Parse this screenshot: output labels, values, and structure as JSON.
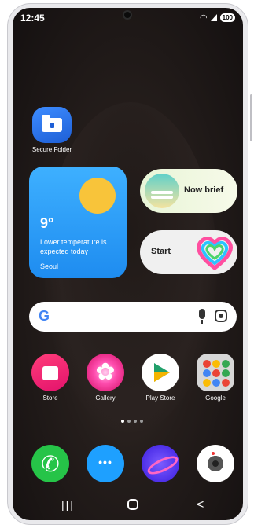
{
  "status": {
    "time": "12:45",
    "battery": "100"
  },
  "secure_folder": {
    "label": "Secure Folder"
  },
  "weather": {
    "temp": "9°",
    "description": "Lower temperature is expected today",
    "city": "Seoul"
  },
  "now_brief": {
    "label": "Now brief"
  },
  "start_widget": {
    "label": "Start"
  },
  "search": {
    "logo": "G"
  },
  "apps_row": [
    {
      "label": "Store"
    },
    {
      "label": "Gallery"
    },
    {
      "label": "Play Store"
    },
    {
      "label": "Google"
    }
  ],
  "pager": {
    "pages": 4,
    "active": 0
  },
  "nav": {
    "recent": "|||",
    "back": "<"
  },
  "colors": {
    "weather_bg": "#2aa0ff",
    "sun": "#f8c43a",
    "play_green": "#22a06b"
  }
}
